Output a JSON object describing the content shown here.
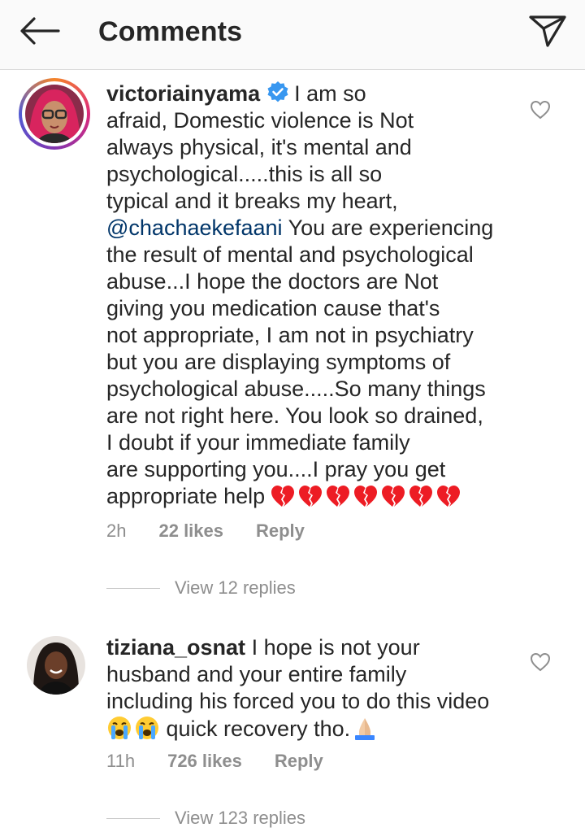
{
  "header": {
    "title": "Comments",
    "back_icon": "arrow-left-icon",
    "send_icon": "paper-plane-icon"
  },
  "comments": [
    {
      "username": "victoriainyama",
      "verified": true,
      "text_part1": "I am so\nafraid, Domestic violence is Not\nalways physical, it's mental and\npsychological.....this is all so\ntypical and it breaks my heart,\n",
      "mention": "@chachaekefaani",
      "text_part2": " You are experiencing\nthe result of mental and psychological\nabuse...I hope the doctors are Not\ngiving you medication cause that's\nnot appropriate, I am not in psychiatry\nbut you are displaying symptoms of\npsychological abuse.....So many things\nare not right here.  You look so drained,\nI doubt if your immediate family\nare supporting you....I pray you get\nappropriate help",
      "emoji_count": 7,
      "emoji_name": "broken-heart-icon",
      "time": "2h",
      "likes": "22 likes",
      "reply_label": "Reply",
      "view_replies": "View 12 replies"
    },
    {
      "username": "tiziana_osnat",
      "verified": false,
      "text_part1": "I hope is not your\nhusband and your entire family\nincluding his forced you to do this video\n",
      "text_part2": " quick recovery tho.",
      "time": "11h",
      "likes": "726 likes",
      "reply_label": "Reply",
      "view_replies": "View 123 replies"
    }
  ],
  "colors": {
    "text": "#262626",
    "secondary": "#8e8e8e",
    "mention": "#003569",
    "verified": "#3897f0",
    "broken_heart": "#ed1c24"
  }
}
